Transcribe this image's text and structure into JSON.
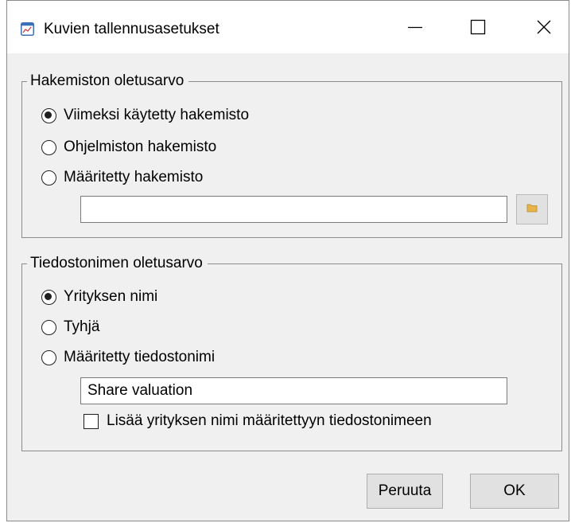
{
  "window": {
    "title": "Kuvien tallennusasetukset",
    "icons": {
      "app": "chart-app-icon",
      "minimize": "minimize-icon",
      "maximize": "maximize-icon",
      "close": "close-icon"
    }
  },
  "directory_group": {
    "legend": "Hakemiston oletusarvo",
    "options": [
      {
        "label": "Viimeksi käytetty hakemisto",
        "checked": true
      },
      {
        "label": "Ohjelmiston hakemisto",
        "checked": false
      },
      {
        "label": "Määritetty hakemisto",
        "checked": false
      }
    ],
    "path_value": "",
    "browse_icon": "folder-icon"
  },
  "filename_group": {
    "legend": "Tiedostonimen oletusarvo",
    "options": [
      {
        "label": "Yrityksen nimi",
        "checked": true
      },
      {
        "label": "Tyhjä",
        "checked": false
      },
      {
        "label": "Määritetty tiedostonimi",
        "checked": false
      }
    ],
    "filename_value": "Share valuation",
    "append_company_label": "Lisää yrityksen nimi määritettyyn tiedostonimeen",
    "append_company_checked": false
  },
  "buttons": {
    "cancel": "Peruuta",
    "ok": "OK"
  },
  "colors": {
    "dialog_bg": "#f0f0f0",
    "titlebar_bg": "#ffffff",
    "button_bg": "#e1e1e1",
    "folder_yellow": "#e8b44a"
  }
}
